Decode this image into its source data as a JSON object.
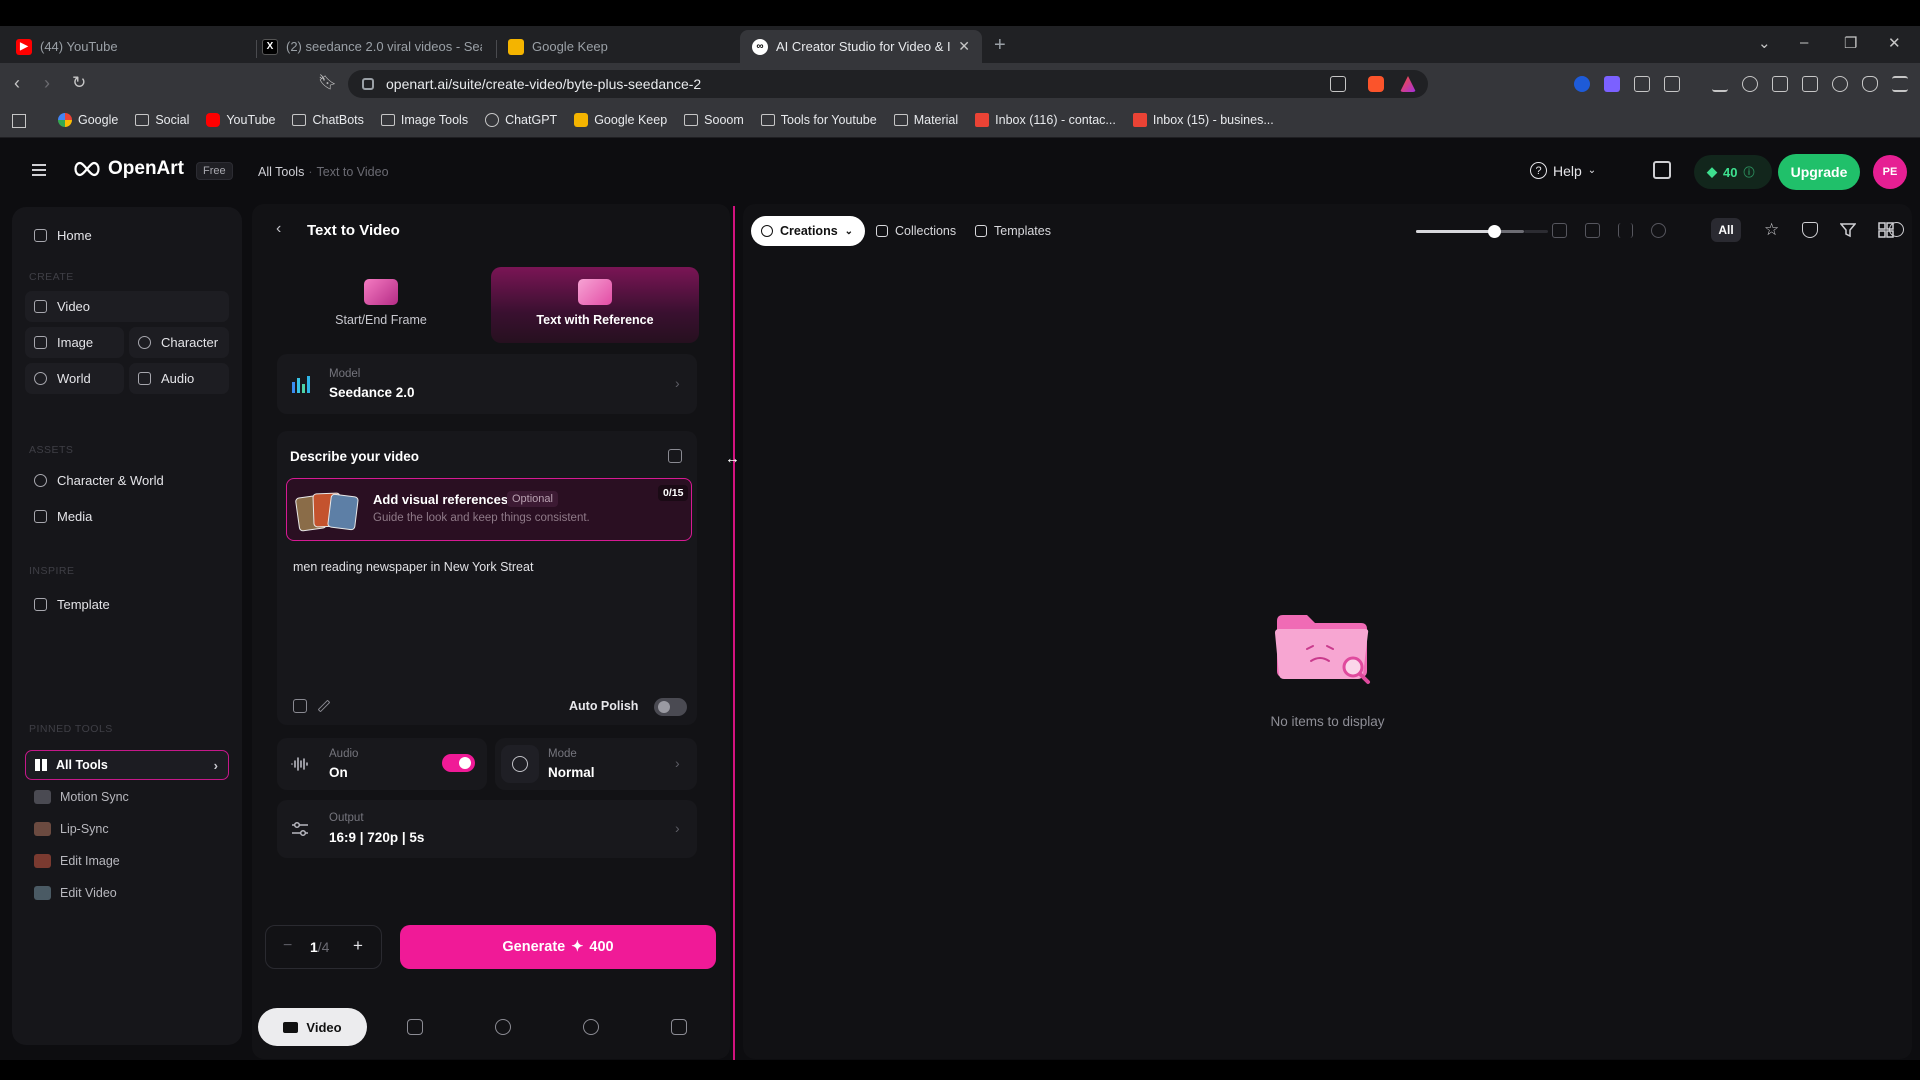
{
  "browser": {
    "tabs": [
      {
        "title": "(44) YouTube",
        "favicon": "youtube-icon"
      },
      {
        "title": "(2) seedance 2.0 viral videos - Search",
        "favicon": "x-icon"
      },
      {
        "title": "Google Keep",
        "favicon": "keep-icon"
      },
      {
        "title": "AI Creator Studio for Video & Im",
        "favicon": "openart-icon"
      }
    ],
    "new_tab": "+",
    "url": "openart.ai/suite/create-video/byte-plus-seedance-2",
    "bookmarks": [
      {
        "label": "Google",
        "icon": "google-icon"
      },
      {
        "label": "Social",
        "icon": "folder-icon"
      },
      {
        "label": "YouTube",
        "icon": "youtube-icon"
      },
      {
        "label": "ChatBots",
        "icon": "folder-icon"
      },
      {
        "label": "Image Tools",
        "icon": "folder-icon"
      },
      {
        "label": "ChatGPT",
        "icon": "chatgpt-icon"
      },
      {
        "label": "Google Keep",
        "icon": "keep-icon"
      },
      {
        "label": "Sooom",
        "icon": "folder-icon"
      },
      {
        "label": "Tools for Youtube",
        "icon": "folder-icon"
      },
      {
        "label": "Material",
        "icon": "folder-icon"
      },
      {
        "label": "Inbox (116) - contac...",
        "icon": "gmail-icon"
      },
      {
        "label": "Inbox (15) - busines...",
        "icon": "gmail-icon"
      }
    ]
  },
  "header": {
    "brand": "OpenArt",
    "plan_badge": "Free",
    "breadcrumb": {
      "root": "All Tools",
      "current": "Text to Video"
    },
    "help": "Help",
    "credits": "40",
    "upgrade": "Upgrade",
    "avatar_initials": "PE"
  },
  "sidebar": {
    "home": "Home",
    "create_label": "CREATE",
    "create": {
      "video": "Video",
      "image": "Image",
      "character": "Character",
      "world": "World",
      "audio": "Audio"
    },
    "assets_label": "ASSETS",
    "assets": {
      "character_world": "Character & World",
      "media": "Media"
    },
    "inspire_label": "INSPIRE",
    "inspire": {
      "template": "Template"
    },
    "pinned_label": "PINNED TOOLS",
    "all_tools": "All Tools",
    "pinned": [
      "Motion Sync",
      "Lip-Sync",
      "Edit Image",
      "Edit Video"
    ]
  },
  "panel": {
    "title": "Text to Video",
    "modes": {
      "start_end": "Start/End Frame",
      "text_ref": "Text with Reference"
    },
    "model": {
      "label": "Model",
      "value": "Seedance 2.0"
    },
    "describe": {
      "title": "Describe your video",
      "ref_title": "Add visual references",
      "ref_optional": "Optional",
      "ref_sub": "Guide the look and keep things consistent.",
      "ref_count": "0/15",
      "prompt": "men reading newspaper in New York Streat",
      "auto_polish": "Auto Polish",
      "auto_polish_on": false
    },
    "audio": {
      "label": "Audio",
      "value": "On",
      "enabled": true
    },
    "mode": {
      "label": "Mode",
      "value": "Normal"
    },
    "output": {
      "label": "Output",
      "value": "16:9 | 720p | 5s"
    },
    "batch": {
      "current": "1",
      "total": "/4",
      "minus": "−",
      "plus": "+"
    },
    "generate": {
      "label": "Generate",
      "cost": "400"
    },
    "bottom_tab_video": "Video"
  },
  "gallery": {
    "tabs": {
      "creations": "Creations",
      "collections": "Collections",
      "templates": "Templates"
    },
    "zoom_level": 0.72,
    "filter_all": "All",
    "empty": "No items to display"
  },
  "colors": {
    "accent": "#f01a97",
    "green": "#20c06a",
    "bg": "#0d0d10"
  }
}
